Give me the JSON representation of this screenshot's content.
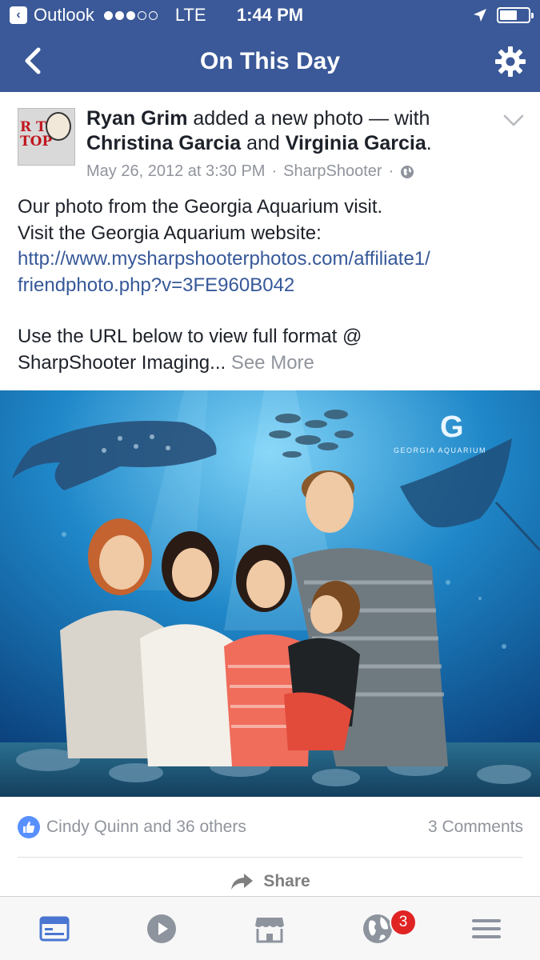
{
  "status_bar": {
    "back_app": "Outlook",
    "carrier_type": "LTE",
    "time": "1:44 PM",
    "signal_bars_filled": 3,
    "signal_bars_total": 5
  },
  "nav": {
    "title": "On This Day",
    "back_icon": "chevron-left-icon",
    "settings_icon": "gear-icon"
  },
  "post": {
    "author": "Ryan Grim",
    "action": "added a new photo — with",
    "tag1": "Christina Garcia",
    "conjunction": "and",
    "tag2": "Virginia Garcia",
    "period": ".",
    "timestamp": "May 26, 2012 at 3:30 PM",
    "separator": "·",
    "source": "SharpShooter",
    "privacy_icon": "globe-icon",
    "body_line1": "Our photo from the Georgia Aquarium visit.",
    "body_line2": "Visit the Georgia Aquarium website:",
    "link_line1": "http://www.mysharpshooterphotos.com/affiliate1/",
    "link_line2": "friendphoto.php?v=3FE960B042",
    "body_line3": "Use the URL below to view full format @",
    "body_line4": "SharpShooter Imaging...",
    "see_more": "See More",
    "avatar_text1": "R THE",
    "avatar_text2": "TOP"
  },
  "photo": {
    "logo_letter": "G",
    "logo_text": "GEORGIA AQUARIUM"
  },
  "reactions": {
    "likes_text": "Cindy Quinn and 36 others",
    "comments_text": "3 Comments",
    "like_icon": "thumbs-up-icon"
  },
  "actions": {
    "share_label": "Share",
    "share_icon": "share-arrow-icon"
  },
  "tab_bar": {
    "tabs": [
      "news-feed-icon",
      "video-icon",
      "marketplace-icon",
      "notifications-globe-icon",
      "menu-icon"
    ],
    "notifications_badge": "3"
  },
  "colors": {
    "brand": "#3b5998",
    "link": "#365899",
    "meta": "#90949c",
    "badge": "#e02424",
    "like": "#5890ff"
  }
}
